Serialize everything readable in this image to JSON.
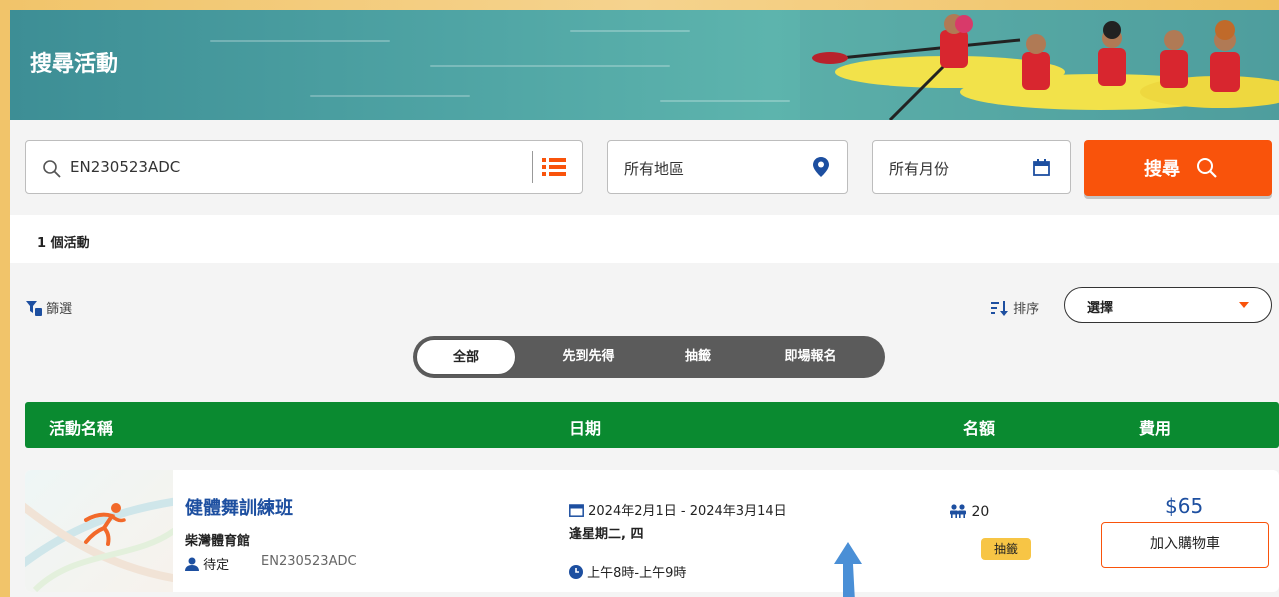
{
  "header": {
    "title": "搜尋活動"
  },
  "search": {
    "keyword": "EN230523ADC",
    "region": "所有地區",
    "month": "所有月份",
    "button_label": "搜尋"
  },
  "results": {
    "count_text": "1 個活動"
  },
  "toolbar": {
    "filter_label": "篩選",
    "sort_label": "排序",
    "sort_value": "選擇"
  },
  "tabs": [
    {
      "label": "全部",
      "active": true
    },
    {
      "label": "先到先得",
      "active": false
    },
    {
      "label": "抽籤",
      "active": false
    },
    {
      "label": "即場報名",
      "active": false
    }
  ],
  "table": {
    "headers": [
      "活動名稱",
      "日期",
      "名額",
      "費用"
    ],
    "rows": [
      {
        "name": "健體舞訓練班",
        "venue": "柴灣體育館",
        "status": "待定",
        "code": "EN230523ADC",
        "date_range": "2024年2月1日 - 2024年3月14日",
        "days": "逢星期二, 四",
        "time": "上午8時-上午9時",
        "quota": "20",
        "method_badge": "抽籤",
        "fee": "$65",
        "cart_label": "加入購物車"
      }
    ]
  },
  "colors": {
    "accent_orange": "#f9530b",
    "header_green": "#0a8a30",
    "link_blue": "#1d4fa0",
    "badge_yellow": "#f7c545"
  }
}
